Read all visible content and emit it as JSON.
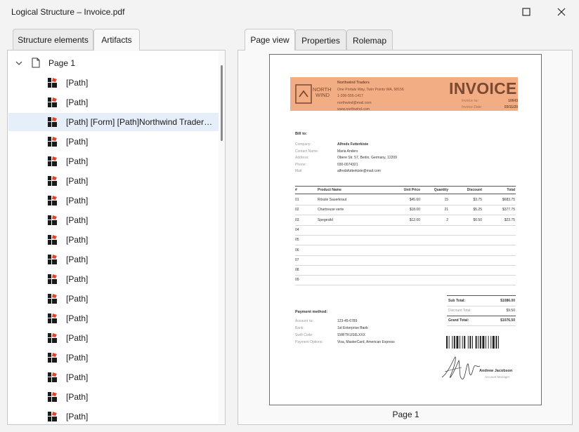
{
  "window": {
    "title": "Logical Structure – Invoice.pdf",
    "maximize_icon": "maximize-icon",
    "close_icon": "close-icon"
  },
  "left_tabs": [
    {
      "label": "Structure elements",
      "active": false
    },
    {
      "label": "Artifacts",
      "active": true
    }
  ],
  "right_tabs": [
    {
      "label": "Page view",
      "active": true
    },
    {
      "label": "Properties",
      "active": false
    },
    {
      "label": "Rolemap",
      "active": false
    }
  ],
  "tree": {
    "root_label": "Page 1",
    "items": [
      "[Path]",
      "[Path]",
      "[Path] [Form] [Path]Northwind Traders[P...",
      "[Path]",
      "[Path]",
      "[Path]",
      "[Path]",
      "[Path]",
      "[Path]",
      "[Path]",
      "[Path]",
      "[Path]",
      "[Path]",
      "[Path]",
      "[Path]",
      "[Path]",
      "[Path]",
      "[Path]"
    ],
    "selected_index": 2
  },
  "page_caption": "Page 1",
  "invoice": {
    "logo_line1": "NORTH",
    "logo_line2": "WIND",
    "company_name": "Northwind Traders",
    "company_address": "One Portals Way, Twin Points WA, 98156",
    "company_phone": "1-206-555-1417",
    "company_email": "northwind@mail.com",
    "company_web": "www.northwind.com",
    "title": "INVOICE",
    "invoice_no_label": "Invoice №:",
    "invoice_no": "10643",
    "invoice_date_label": "Invoice Date:",
    "invoice_date": "03/11/20",
    "bill_to": "Bill to:",
    "bill_labels": [
      "Company:",
      "Contact Name:",
      "Address:",
      "Phone:",
      "Mail:"
    ],
    "bill_values": [
      "Alfreds Futterkiste",
      "Maria Anders",
      "Obere Str. 57, Berlin, Germany, 12209",
      "030-0074321",
      "alfredsfutterkiste@mail.com"
    ],
    "columns": [
      "#",
      "Product Name",
      "Unit Price",
      "Quantity",
      "Discount",
      "Total"
    ],
    "rows": [
      [
        "01",
        "Rössle Sauerkraut",
        "$45.60",
        "15",
        "$3.75",
        "$683.75"
      ],
      [
        "02",
        "Chartreuse verte",
        "$18.00",
        "21",
        "$5.25",
        "$377.75"
      ],
      [
        "03",
        "Spegesild",
        "$12.00",
        "2",
        "$0.50",
        "$23.75"
      ],
      [
        "04",
        "",
        "",
        "",
        "",
        ""
      ],
      [
        "05",
        "",
        "",
        "",
        "",
        ""
      ],
      [
        "06",
        "",
        "",
        "",
        "",
        ""
      ],
      [
        "07",
        "",
        "",
        "",
        "",
        ""
      ],
      [
        "08",
        "",
        "",
        "",
        "",
        ""
      ],
      [
        "09",
        "",
        "",
        "",
        "",
        ""
      ]
    ],
    "sub_total_label": "Sub Total:",
    "sub_total": "$1086.00",
    "discount_total_label": "Discount Total:",
    "discount_total": "$9.50",
    "grand_total_label": "Grand Total:",
    "grand_total": "$1076.50",
    "payment_method": "Payment method:",
    "pay_labels": [
      "Account №:",
      "Bank:",
      "Swift Code:",
      "Payment Options:"
    ],
    "pay_values": [
      "123-45-6789",
      "1st Enterprise Bank",
      "SWFTKUS6LXXX",
      "Visa, MasterCard, American Express"
    ],
    "signer_name": "Andrew Jacobson",
    "signer_title": "Account Manager"
  }
}
